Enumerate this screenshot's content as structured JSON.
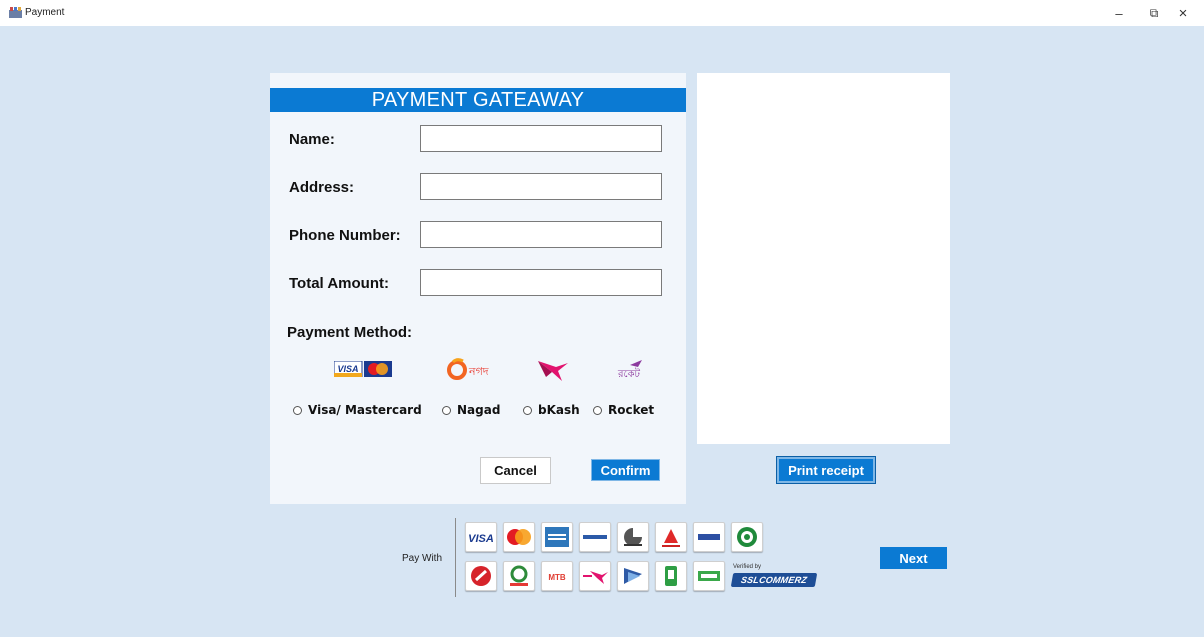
{
  "window": {
    "title": "Payment",
    "minimize_glyph": "–",
    "restore_glyph": "⧉",
    "close_glyph": "×"
  },
  "form": {
    "header": "PAYMENT GATEAWAY",
    "fields": [
      {
        "label": "Name:",
        "value": "",
        "placeholder": ""
      },
      {
        "label": "Address:",
        "value": "",
        "placeholder": ""
      },
      {
        "label": "Phone Number:",
        "value": "",
        "placeholder": ""
      },
      {
        "label": "Total Amount:",
        "value": "",
        "placeholder": ""
      }
    ],
    "payment_method_label": "Payment Method:",
    "nagad_logo_text": "নগদ",
    "rocket_logo_text": "রকেট",
    "methods": [
      {
        "label": "Visa/ Mastercard"
      },
      {
        "label": "Nagad"
      },
      {
        "label": "bKash"
      },
      {
        "label": "Rocket"
      }
    ],
    "cancel_label": "Cancel",
    "confirm_label": "Confirm"
  },
  "receipt": {
    "print_label": "Print receipt"
  },
  "pay_with": {
    "label": "Pay With",
    "visa_text": "VISA",
    "mtb_text": "MTB",
    "verified_text": "Verified by",
    "sslcommerz_text": "SSLCOMMERZ"
  },
  "next_label": "Next",
  "colors": {
    "accent": "#0b7ad3",
    "background": "#d7e5f3",
    "panel": "#f2f6fb"
  },
  "icons": [
    "app-icon",
    "minimize-icon",
    "restore-icon",
    "close-icon",
    "visa-logo-icon",
    "mastercard-logo-icon",
    "nagad-logo-icon",
    "bkash-logo-icon",
    "rocket-logo-icon"
  ]
}
